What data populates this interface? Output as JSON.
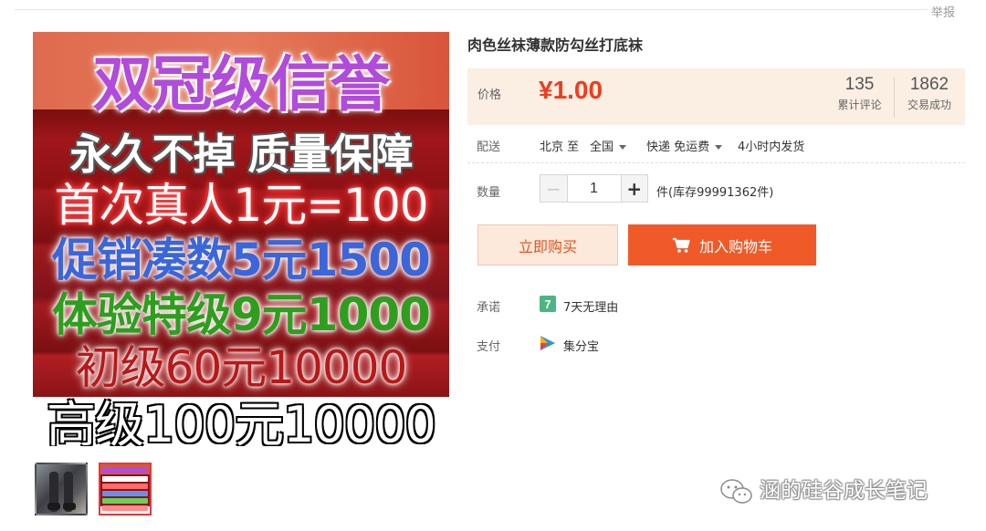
{
  "header": {
    "report_link": "举报"
  },
  "gallery": {
    "ad_lines": [
      "双冠级信誉",
      "永久不掉 质量保障",
      "首次真人1元=100",
      "促销凑数5元1500",
      "体验特级9元1000",
      "初级60元10000",
      "高级100元10000"
    ]
  },
  "product": {
    "title": "肉色丝袜薄款防勾丝打底袜",
    "price_label": "价格",
    "price": "¥1.00",
    "reviews_count": "135",
    "reviews_label": "累计评论",
    "deals_count": "1862",
    "deals_label": "交易成功"
  },
  "delivery": {
    "label": "配送",
    "from": "北京 至",
    "to": "全国",
    "method": "快递 免运费",
    "ship_time": "4小时内发货"
  },
  "quantity": {
    "label": "数量",
    "value": "1",
    "stock_text": "件(库存99991362件)"
  },
  "actions": {
    "buy_now": "立即购买",
    "add_to_cart": "加入购物车"
  },
  "promise": {
    "label": "承诺",
    "badge": "7",
    "text": "7天无理由"
  },
  "payment": {
    "label": "支付",
    "text": "集分宝"
  },
  "watermark": {
    "text": "涵的硅谷成长笔记"
  },
  "colors": {
    "accent": "#f05a28",
    "price": "#f03c1e",
    "price_bg": "#fbeee3",
    "promise_green": "#4cb581"
  }
}
